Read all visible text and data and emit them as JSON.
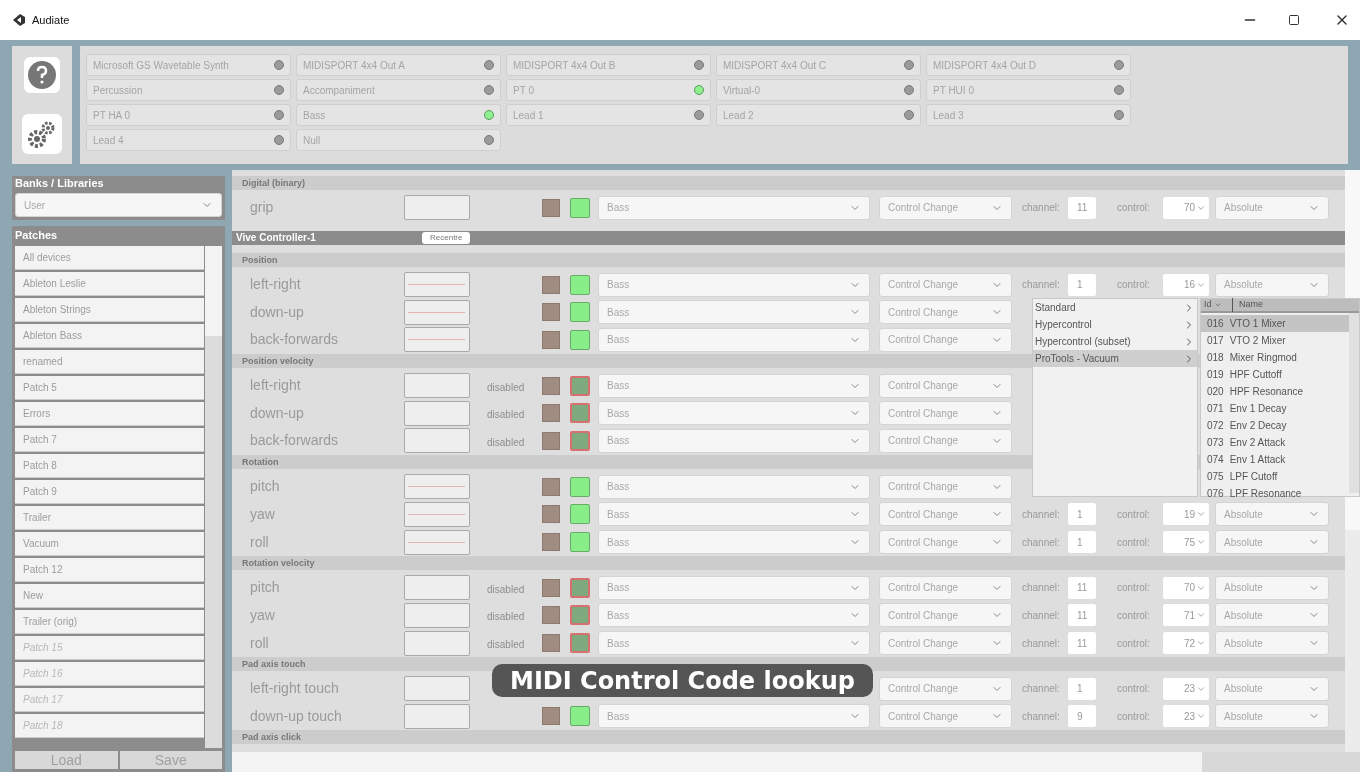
{
  "window": {
    "title": "Audiate"
  },
  "devices": [
    {
      "name": "Microsoft GS Wavetable Synth",
      "on": false
    },
    {
      "name": "MIDISPORT 4x4 Out A",
      "on": false
    },
    {
      "name": "MIDISPORT 4x4 Out B",
      "on": false
    },
    {
      "name": "MIDISPORT 4x4 Out C",
      "on": false
    },
    {
      "name": "MIDISPORT 4x4 Out D",
      "on": false
    },
    {
      "name": "Percussion",
      "on": false
    },
    {
      "name": "Accompaniment",
      "on": false
    },
    {
      "name": "PT 0",
      "on": true
    },
    {
      "name": "Virtual-0",
      "on": false
    },
    {
      "name": "PT HUI 0",
      "on": false
    },
    {
      "name": "PT HA 0",
      "on": false
    },
    {
      "name": "Bass",
      "on": true
    },
    {
      "name": "Lead 1",
      "on": false
    },
    {
      "name": "Lead 2",
      "on": false
    },
    {
      "name": "Lead 3",
      "on": false
    },
    {
      "name": "Lead 4",
      "on": false
    },
    {
      "name": "Null",
      "on": false
    }
  ],
  "sidebar": {
    "banks_title": "Banks / Libraries",
    "bank": "User",
    "patches_title": "Patches",
    "patches": [
      {
        "name": "All devices",
        "empty": false
      },
      {
        "name": "Ableton Leslie",
        "empty": false
      },
      {
        "name": "Ableton Strings",
        "empty": false
      },
      {
        "name": "Ableton Bass",
        "empty": false
      },
      {
        "name": "renamed",
        "empty": false
      },
      {
        "name": "Patch 5",
        "empty": false
      },
      {
        "name": "Errors",
        "empty": false
      },
      {
        "name": "Patch 7",
        "empty": false
      },
      {
        "name": "Patch 8",
        "empty": false
      },
      {
        "name": "Patch 9",
        "empty": false
      },
      {
        "name": "Trailer",
        "empty": false
      },
      {
        "name": "Vacuum",
        "empty": false
      },
      {
        "name": "Patch 12",
        "empty": false
      },
      {
        "name": "New",
        "empty": false
      },
      {
        "name": "Trailer (orig)",
        "empty": false
      },
      {
        "name": "Patch 15",
        "empty": true
      },
      {
        "name": "Patch 16",
        "empty": true
      },
      {
        "name": "Patch 17",
        "empty": true
      },
      {
        "name": "Patch 18",
        "empty": true
      }
    ],
    "buttons": [
      "Load",
      "Save"
    ]
  },
  "sections": [
    {
      "kind": "group",
      "title": "Digital (binary)",
      "rows": [
        {
          "label": "grip",
          "trace": false,
          "active": true,
          "target": "Bass",
          "type": "Control Change",
          "channel_label": "channel:",
          "channel": "11",
          "control_label": "control:",
          "control": "70",
          "mode": "Absolute"
        }
      ]
    },
    {
      "kind": "device",
      "title": "Vive Controller-1",
      "button": "Recentre"
    },
    {
      "kind": "group",
      "title": "Position",
      "rows": [
        {
          "label": "left-right",
          "trace": true,
          "active": true,
          "target": "Bass",
          "type": "Control Change",
          "channel_label": "channel:",
          "channel": "1",
          "control_label": "control:",
          "control": "16",
          "mode": "Absolute"
        },
        {
          "label": "down-up",
          "trace": true,
          "active": true,
          "target": "Bass",
          "type": "Control Change"
        },
        {
          "label": "back-forwards",
          "trace": true,
          "active": true,
          "target": "Bass",
          "type": "Control Change"
        }
      ]
    },
    {
      "kind": "group",
      "title": "Position velocity",
      "rows": [
        {
          "label": "left-right",
          "trace": false,
          "status": "disabled",
          "active": false,
          "target": "Bass",
          "type": "Control Change"
        },
        {
          "label": "down-up",
          "trace": false,
          "status": "disabled",
          "active": false,
          "target": "Bass",
          "type": "Control Change"
        },
        {
          "label": "back-forwards",
          "trace": false,
          "status": "disabled",
          "active": false,
          "target": "Bass",
          "type": "Control Change"
        }
      ]
    },
    {
      "kind": "group",
      "title": "Rotation",
      "rows": [
        {
          "label": "pitch",
          "trace": true,
          "active": true,
          "target": "Bass",
          "type": "Control Change"
        },
        {
          "label": "yaw",
          "trace": true,
          "active": true,
          "target": "Bass",
          "type": "Control Change",
          "channel_label": "channel:",
          "channel": "1",
          "control_label": "control:",
          "control": "19",
          "mode": "Absolute"
        },
        {
          "label": "roll",
          "trace": true,
          "active": true,
          "target": "Bass",
          "type": "Control Change",
          "channel_label": "channel:",
          "channel": "1",
          "control_label": "control:",
          "control": "75",
          "mode": "Absolute"
        }
      ]
    },
    {
      "kind": "group",
      "title": "Rotation velocity",
      "rows": [
        {
          "label": "pitch",
          "trace": false,
          "status": "disabled",
          "active": false,
          "target": "Bass",
          "type": "Control Change",
          "channel_label": "channel:",
          "channel": "11",
          "control_label": "control:",
          "control": "70",
          "mode": "Absolute"
        },
        {
          "label": "yaw",
          "trace": false,
          "status": "disabled",
          "active": false,
          "target": "Bass",
          "type": "Control Change",
          "channel_label": "channel:",
          "channel": "11",
          "control_label": "control:",
          "control": "71",
          "mode": "Absolute"
        },
        {
          "label": "roll",
          "trace": false,
          "status": "disabled",
          "active": false,
          "target": "Bass",
          "type": "Control Change",
          "channel_label": "channel:",
          "channel": "11",
          "control_label": "control:",
          "control": "72",
          "mode": "Absolute"
        }
      ]
    },
    {
      "kind": "group",
      "title": "Pad axis touch",
      "rows": [
        {
          "label": "left-right touch",
          "trace": false,
          "type": "Control Change",
          "channel_label": "channel:",
          "channel": "1",
          "control_label": "control:",
          "control": "23",
          "mode": "Absolute"
        },
        {
          "label": "down-up touch",
          "trace": false,
          "active": true,
          "target": "Bass",
          "type": "Control Change",
          "channel_label": "channel:",
          "channel": "9",
          "control_label": "control:",
          "control": "23",
          "mode": "Absolute"
        }
      ]
    },
    {
      "kind": "group",
      "title": "Pad axis click"
    }
  ],
  "menu": {
    "items": [
      {
        "label": "Standard",
        "selected": false
      },
      {
        "label": "Hypercontrol",
        "selected": false
      },
      {
        "label": "Hypercontrol (subset)",
        "selected": false
      },
      {
        "label": "ProTools - Vacuum",
        "selected": true
      }
    ],
    "columns": [
      "Id",
      "Name"
    ],
    "codes": [
      {
        "id": "016",
        "name": "VTO 1 Mixer",
        "selected": true
      },
      {
        "id": "017",
        "name": "VTO 2 Mixer",
        "selected": false
      },
      {
        "id": "018",
        "name": "Mixer Ringmod",
        "selected": false
      },
      {
        "id": "019",
        "name": "HPF Cuttoff",
        "selected": false
      },
      {
        "id": "020",
        "name": "HPF Resonance",
        "selected": false
      },
      {
        "id": "071",
        "name": "Env 1 Decay",
        "selected": false
      },
      {
        "id": "072",
        "name": "Env 2 Decay",
        "selected": false
      },
      {
        "id": "073",
        "name": "Env 2 Attack",
        "selected": false
      },
      {
        "id": "074",
        "name": "Env 1 Attack",
        "selected": false
      },
      {
        "id": "075",
        "name": "LPF Cutoff",
        "selected": false
      },
      {
        "id": "076",
        "name": "LPF Resonance",
        "selected": false
      }
    ]
  },
  "caption": "MIDI Control Code lookup"
}
